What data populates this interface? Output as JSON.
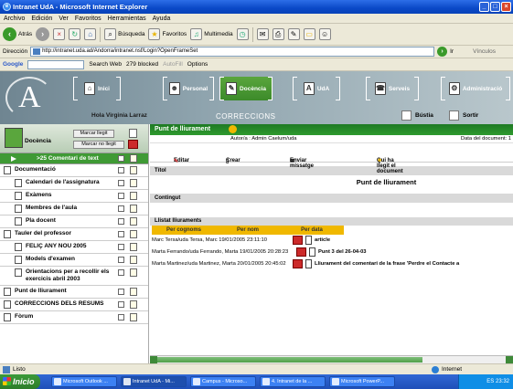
{
  "window": {
    "title": "Intranet UdA - Microsoft Internet Explorer"
  },
  "menu": [
    "Archivo",
    "Edición",
    "Ver",
    "Favoritos",
    "Herramientas",
    "Ayuda"
  ],
  "toolbar": {
    "back": "Atrás",
    "search": "Búsqueda",
    "favorites": "Favoritos",
    "multimedia": "Multimedia"
  },
  "address": {
    "label": "Dirección",
    "url": "http://intranet.uda.ad/Andorra/intranet.nsf/Login?OpenFrameSet",
    "go": "Ir",
    "links": "Vínculos"
  },
  "google": {
    "brand": "Google",
    "search_web": "Search Web",
    "blocked": "279 blocked",
    "autofill": "AutoFill",
    "options": "Options"
  },
  "nav": {
    "inici": "Inici",
    "personal": "Personal",
    "docencia": "Docència",
    "uda": "UdA",
    "serveis": "Serveis",
    "administracio": "Administració"
  },
  "header": {
    "user": "Hola Virginia Larraz",
    "section": "CORRECCIONS",
    "bustia": "Bústia",
    "sortir": "Sortir"
  },
  "sidebar": {
    "title": "Docència",
    "marcar_llegit": "Marcar llegit",
    "marcar_no_llegit": "Marcar no llegit",
    "highlight": ">25 Comentari de text",
    "items": [
      {
        "label": "Documentació",
        "level": 0
      },
      {
        "label": "Calendari de l'assignatura",
        "level": 1
      },
      {
        "label": "Exàmens",
        "level": 1
      },
      {
        "label": "Membres de l'aula",
        "level": 1
      },
      {
        "label": "Pla docent",
        "level": 1
      },
      {
        "label": "Tauler del professor",
        "level": 0
      },
      {
        "label": "FELIÇ ANY NOU 2005",
        "level": 1
      },
      {
        "label": "Models d'examen",
        "level": 1
      },
      {
        "label": "Orientacions per a recollir els exercicis abril 2003",
        "level": 1
      },
      {
        "label": "Punt de lliurament",
        "level": 0
      },
      {
        "label": "CORRECCIONS DELS RESUMS",
        "level": 0
      },
      {
        "label": "Fòrum",
        "level": 0
      }
    ]
  },
  "doc": {
    "heading": "Punt de lliurament",
    "author": "Autor/a : Admin Caelum/uda",
    "date": "Data del document: 1",
    "actions": {
      "editar": "Editar",
      "crear": "Crear",
      "enviar": "Enviar missatge",
      "qui": "Qui ha llegit el document"
    },
    "field_titol": "Títol",
    "titol_value": "Punt de lliurament",
    "field_contingut": "Contingut",
    "llistat": "Llistat lliuraments",
    "sort": [
      "Per cognoms",
      "Per nom",
      "Per data"
    ],
    "rows": [
      {
        "name": "Marc Tersa/uda    Tersa,    Marc  19/01/2005 23:11:10",
        "title": "article"
      },
      {
        "name": "Marta Ferrando/uda Ferrando, Marta 19/01/2005 20:28:23",
        "title": "Punt 3 del 26-04-03"
      },
      {
        "name": "Marta Martinez/uda Martinez, Marta 20/01/2005 20:45:02",
        "title": "Lliurament del comentari de la frase 'Perdre el Contacte a"
      }
    ]
  },
  "status": {
    "text": "Listo",
    "zone": "Internet"
  },
  "taskbar": {
    "start": "Inicio",
    "tasks": [
      "Microsoft Outlook ...",
      "Intranet UdA - Mi...",
      "Campus - Microso...",
      "4. Intranet de la ...",
      "Microsoft PowerP..."
    ],
    "lang": "ES",
    "time": "23:32"
  }
}
